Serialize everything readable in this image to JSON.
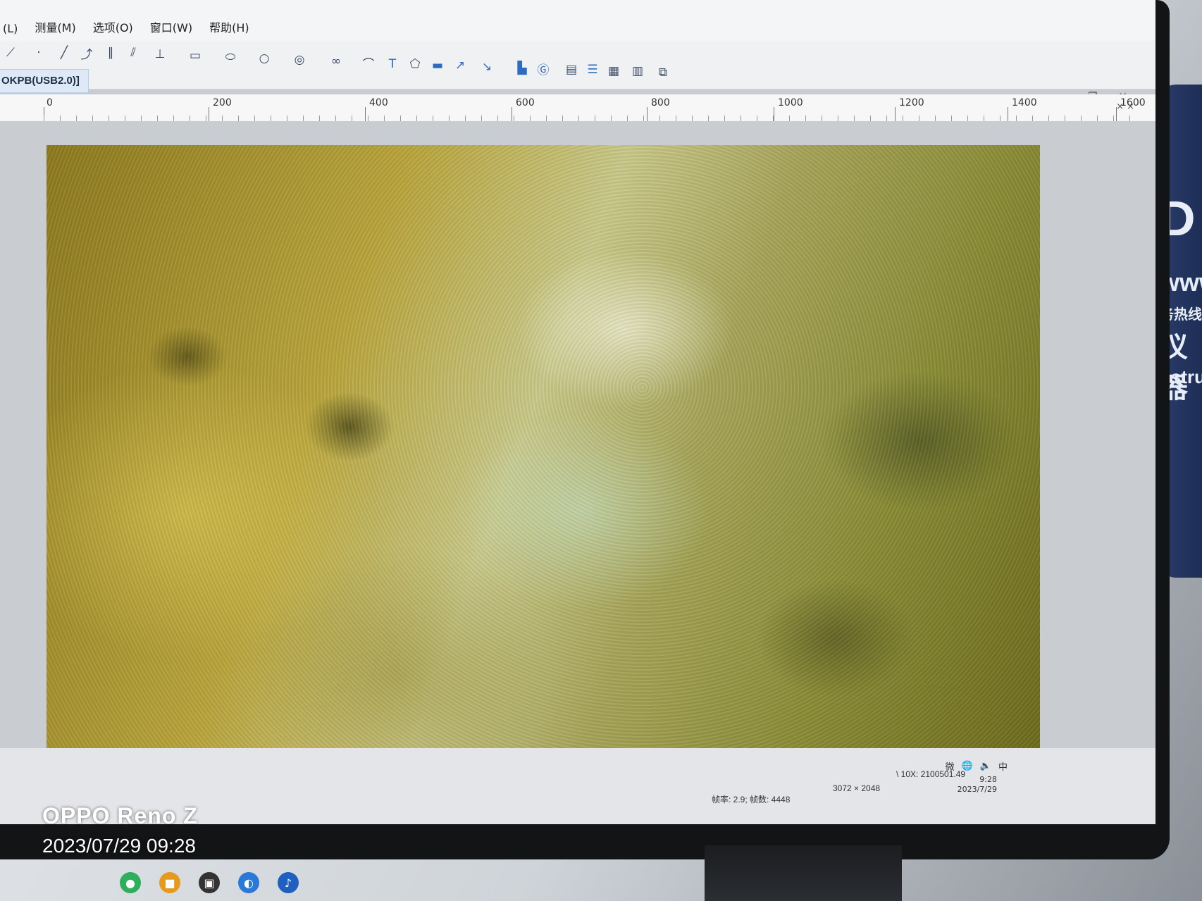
{
  "menus": [
    "(L)",
    "测量(M)",
    "选项(O)",
    "窗口(W)",
    "帮助(H)"
  ],
  "window_controls": {
    "minimize": "—",
    "restore": "❐",
    "close": "✕"
  },
  "device_tab": "OKPB(USB2.0)]",
  "ruler": {
    "labels": [
      "0",
      "200",
      "400",
      "600",
      "800",
      "1000",
      "1200",
      "1400",
      "1600"
    ],
    "close": "× ×"
  },
  "toolbar_icons": [
    "line-tool-icon",
    "point-tool-icon",
    "line-icon",
    "polyline-icon",
    "parallel-lines-icon",
    "multi-parallel-icon",
    "perpendicular-icon",
    "rectangle-icon",
    "ellipse-icon",
    "circle-icon",
    "concentric-circles-icon",
    "link-icon",
    "arc-icon",
    "text-icon",
    "polygon-icon",
    "scale-bar-icon",
    "arrow-icon",
    "pointer-icon",
    "histogram-icon",
    "calibration-icon",
    "export-icon",
    "align-icon",
    "grid-icon",
    "layer-icon",
    "copy-icon"
  ],
  "status": {
    "fps": "帧率: 2.9; 帧数: 4448",
    "resolution": "3072 × 2048",
    "magnification": "\\ 10X: 2100501.49",
    "ime": "微",
    "clock_time": "9:28",
    "clock_date": "2023/7/29",
    "lang": "中"
  },
  "watermark": {
    "brand": "OPPO Reno Z",
    "datetime": "2023/07/29 09:28"
  },
  "side_text": [
    "D",
    "www",
    "务热线",
    "仪器",
    "nstrum"
  ]
}
